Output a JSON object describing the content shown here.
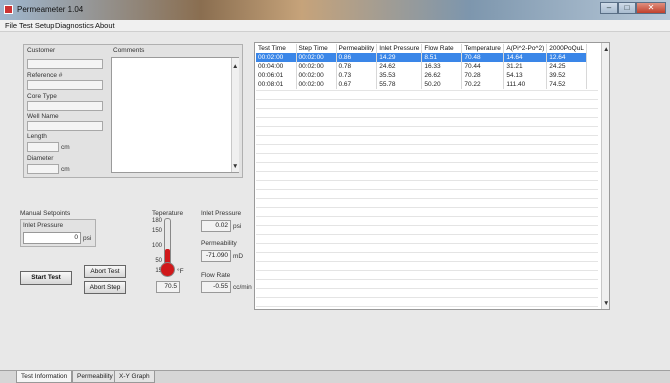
{
  "window": {
    "title": "Permeameter 1.04",
    "btn_min": "–",
    "btn_max": "□",
    "btn_close": "✕"
  },
  "menu": [
    "File",
    "Test Setup",
    "Diagnostics",
    "About"
  ],
  "info": {
    "customer_label": "Customer",
    "comments_label": "Comments",
    "reference_label": "Reference #",
    "core_type_label": "Core Type",
    "well_name_label": "Well Name",
    "length_label": "Length",
    "length_unit": "cm",
    "diameter_label": "Diameter",
    "diameter_unit": "cm"
  },
  "setpoints": {
    "title": "Manual Setpoints",
    "inlet_label": "Inlet Pressure",
    "inlet_value": "0",
    "inlet_unit": "psi"
  },
  "buttons": {
    "start": "Start Test",
    "abort_test": "Abort Test",
    "abort_step": "Abort Step"
  },
  "readouts": {
    "temperature_label": "Teperature",
    "temperature_value": "70.5",
    "temperature_unit": "°F",
    "temperature_ticks": [
      "180",
      "150",
      "100",
      "50",
      "15"
    ],
    "temperature_level": 0.38,
    "inlet_label": "Inlet Pressure",
    "inlet_value": "0.02",
    "inlet_unit": "psi",
    "perm_label": "Permeability",
    "perm_value": "-71.090",
    "perm_unit": "mD",
    "flow_label": "Flow Rate",
    "flow_value": "-0.55",
    "flow_unit": "cc/min"
  },
  "table": {
    "columns": [
      "Test Time",
      "Step Time",
      "Permeability",
      "Inlet Pressure",
      "Flow Rate",
      "Temperature",
      "A(Pi^2-Po^2)",
      "2000PoQuL"
    ],
    "rows": [
      [
        "00:02:00",
        "00:02:00",
        "0.86",
        "14.29",
        "8.51",
        "70.48",
        "14.64",
        "12.64"
      ],
      [
        "00:04:00",
        "00:02:00",
        "0.78",
        "24.62",
        "16.33",
        "70.44",
        "31.21",
        "24.25"
      ],
      [
        "00:06:01",
        "00:02:00",
        "0.73",
        "35.53",
        "26.62",
        "70.28",
        "54.13",
        "39.52"
      ],
      [
        "00:08:01",
        "00:02:00",
        "0.67",
        "55.78",
        "50.20",
        "70.22",
        "111.40",
        "74.52"
      ]
    ]
  },
  "tabs": [
    "Test Information",
    "Permeability",
    "X-Y Graph"
  ]
}
